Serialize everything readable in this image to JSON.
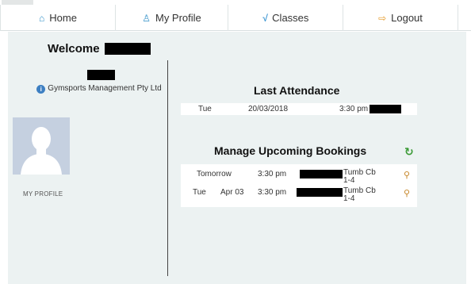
{
  "nav": {
    "items": [
      {
        "label": "Home",
        "icon": "home-icon"
      },
      {
        "label": "My Profile",
        "icon": "profile-icon"
      },
      {
        "label": "Classes",
        "icon": "classes-icon"
      },
      {
        "label": "Logout",
        "icon": "logout-icon"
      }
    ]
  },
  "welcome": {
    "label": "Welcome"
  },
  "sidebar": {
    "company": "Gymsports Management Pty Ltd",
    "profile_link": "MY PROFILE"
  },
  "last_attendance": {
    "title": "Last Attendance",
    "day": "Tue",
    "date": "20/03/2018",
    "time": "3:30 pm"
  },
  "bookings": {
    "title": "Manage Upcoming Bookings",
    "rows": [
      {
        "day": "Tomorrow",
        "date": "",
        "time": "3:30 pm",
        "class": "Tumb Cb 1-4"
      },
      {
        "day": "Tue",
        "date": "Apr 03",
        "time": "3:30 pm",
        "class": "Tumb Cb 1-4"
      }
    ]
  },
  "colors": {
    "panel_bg": "#ecf2f2",
    "accent_blue": "#2f8fc7",
    "refresh_green": "#3a9a35"
  }
}
